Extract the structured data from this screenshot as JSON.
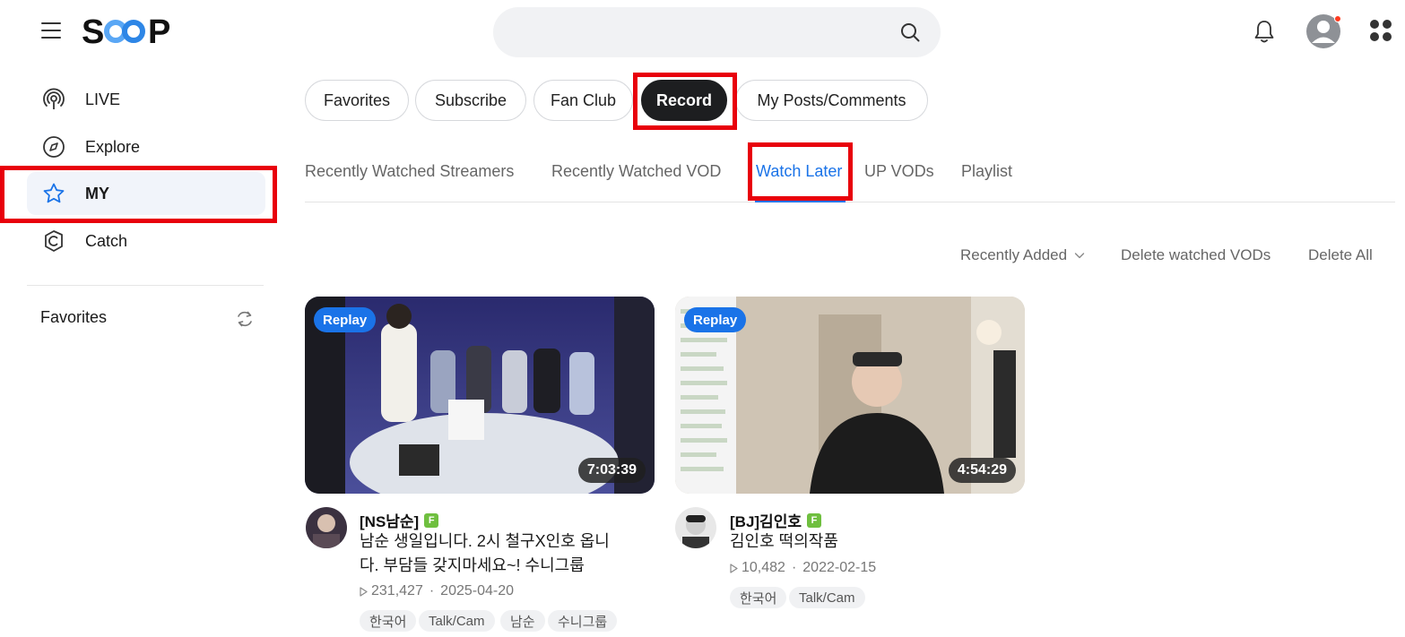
{
  "header": {
    "logo_text": "SOOP",
    "search": {
      "value": "",
      "placeholder": ""
    }
  },
  "sidebar": {
    "items": [
      {
        "label": "LIVE",
        "icon": "live-icon"
      },
      {
        "label": "Explore",
        "icon": "explore-icon"
      },
      {
        "label": "MY",
        "icon": "star-icon",
        "active": true
      },
      {
        "label": "Catch",
        "icon": "catch-icon"
      }
    ],
    "favorites_title": "Favorites"
  },
  "tabs": [
    {
      "label": "Favorites"
    },
    {
      "label": "Subscribe"
    },
    {
      "label": "Fan Club"
    },
    {
      "label": "Record",
      "active": true
    },
    {
      "label": "My Posts/Comments"
    }
  ],
  "subtabs": [
    {
      "label": "Recently Watched Streamers"
    },
    {
      "label": "Recently Watched VOD"
    },
    {
      "label": "Watch Later",
      "active": true
    },
    {
      "label": "UP VODs"
    },
    {
      "label": "Playlist"
    }
  ],
  "actions": {
    "sort": "Recently Added",
    "delete_watched": "Delete watched VODs",
    "delete_all": "Delete All"
  },
  "videos": [
    {
      "badge": "Replay",
      "duration": "7:03:39",
      "channel": "[NS남순]",
      "channel_badge": "F",
      "title": "남순 생일입니다. 2시 철구X인호 옵니다. 부담들 갖지마세요~! 수니그룹",
      "views": "231,427",
      "date": "2025-04-20",
      "tags": [
        "한국어",
        "Talk/Cam",
        "남순",
        "수니그룹"
      ]
    },
    {
      "badge": "Replay",
      "duration": "4:54:29",
      "channel": "[BJ]김인호",
      "channel_badge": "F",
      "title": "김인호 떡의작품",
      "views": "10,482",
      "date": "2022-02-15",
      "tags": [
        "한국어",
        "Talk/Cam"
      ]
    }
  ],
  "meta_separator": "·",
  "colors": {
    "accent": "#1a73e8",
    "highlight": "#e8000b",
    "active_pill": "#1d1e20",
    "replay_badge": "#1a73e8",
    "fan_badge": "#6fbf3f"
  }
}
